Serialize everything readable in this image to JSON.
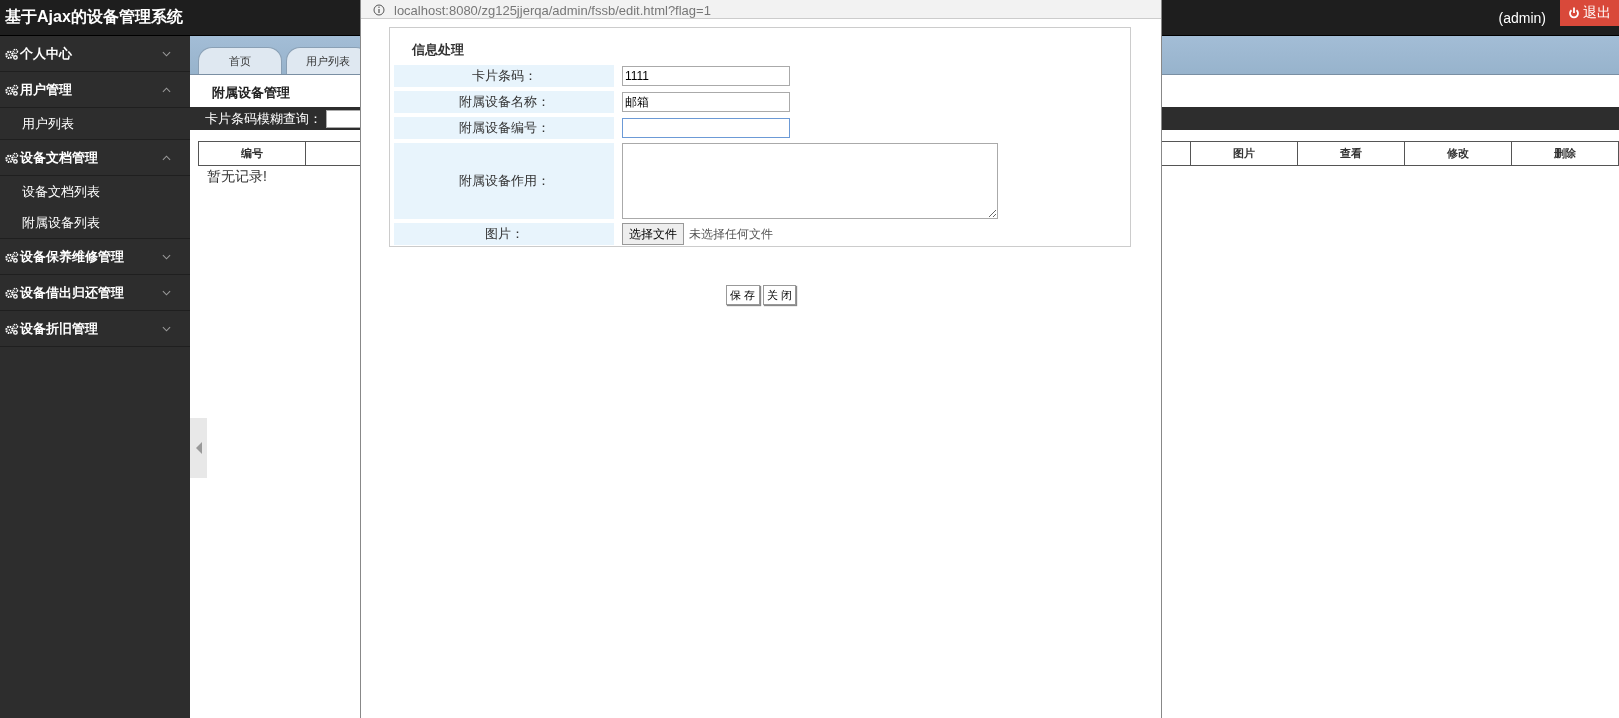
{
  "header": {
    "title": "基于Ajax的设备管理系统",
    "user": "(admin)",
    "logout": "退出"
  },
  "sidebar": {
    "groups": [
      {
        "label": "个人中心",
        "expanded": false
      },
      {
        "label": "用户管理",
        "expanded": true,
        "children": [
          "用户列表"
        ]
      },
      {
        "label": "设备文档管理",
        "expanded": true,
        "children": [
          "设备文档列表",
          "附属设备列表"
        ]
      },
      {
        "label": "设备保养维修管理",
        "expanded": false
      },
      {
        "label": "设备借出归还管理",
        "expanded": false
      },
      {
        "label": "设备折旧管理",
        "expanded": false
      }
    ]
  },
  "tabs": [
    {
      "label": "首页",
      "selected": false
    },
    {
      "label": "用户列表",
      "selected": false
    }
  ],
  "page": {
    "heading": "附属设备管理",
    "search_label": "卡片条码模糊查询：",
    "table": {
      "columns": [
        "编号",
        "图片",
        "查看",
        "修改",
        "删除"
      ],
      "empty_text": "暂无记录!"
    }
  },
  "dialog": {
    "url": "localhost:8080/zg125jjerqa/admin/fssb/edit.html?flag=1",
    "section_title": "信息处理",
    "fields": [
      {
        "kind": "text",
        "label": "卡片条码：",
        "value": "1111",
        "focused": false
      },
      {
        "kind": "text",
        "label": "附属设备名称：",
        "value": "邮箱",
        "focused": false
      },
      {
        "kind": "text",
        "label": "附属设备编号：",
        "focused": true
      },
      {
        "kind": "textarea",
        "label": "附属设备作用：",
        "focused": false
      },
      {
        "kind": "file",
        "label": "图片：",
        "button": "选择文件",
        "status": "未选择任何文件"
      }
    ],
    "buttons": [
      "保 存",
      "关 闭"
    ]
  }
}
